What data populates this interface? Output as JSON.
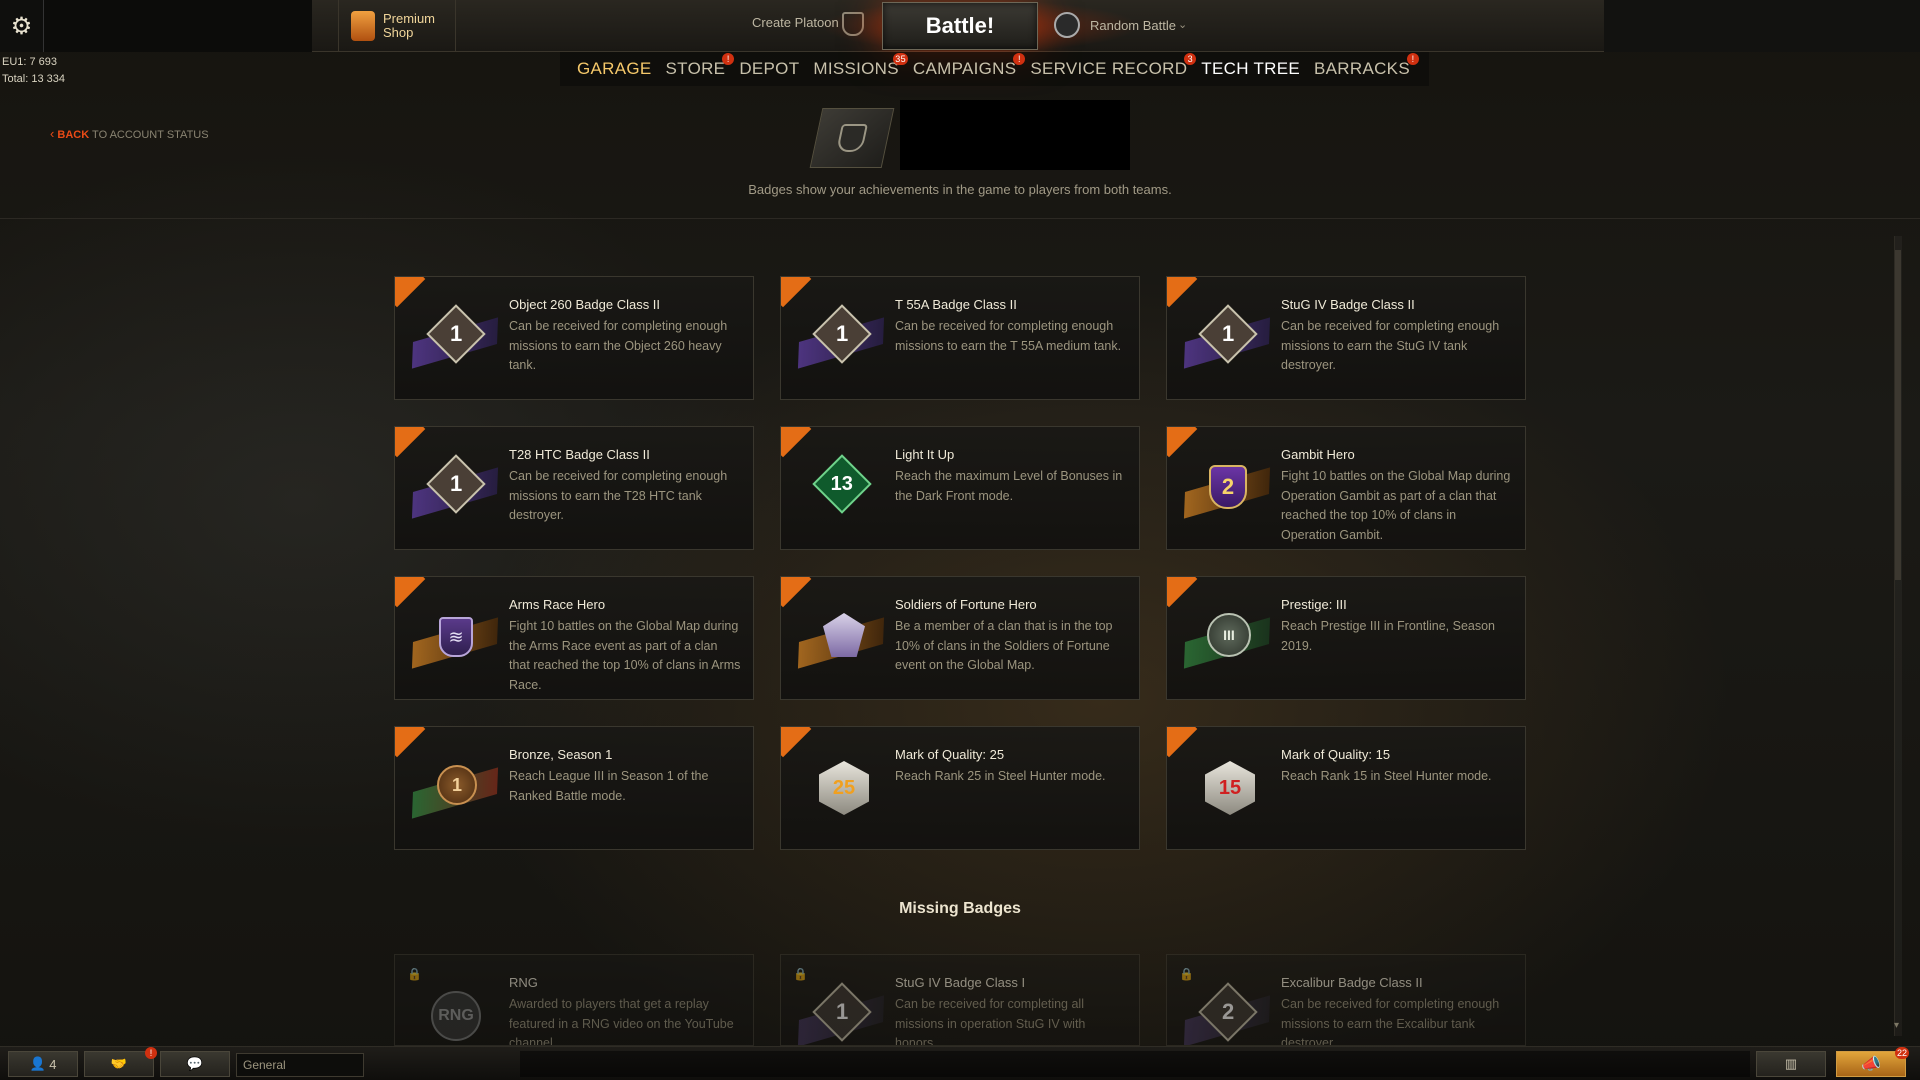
{
  "account": {
    "eu1_label": "EU1: 7 693",
    "total_label": "Total: 13 334"
  },
  "topbar": {
    "premium_line1": "Premium",
    "premium_line2": "Shop",
    "create_platoon": "Create Platoon",
    "battle": "Battle!",
    "battle_mode": "Random Battle"
  },
  "nav": [
    {
      "label": "Garage",
      "badge": ""
    },
    {
      "label": "Store",
      "badge": "!"
    },
    {
      "label": "Depot",
      "badge": ""
    },
    {
      "label": "Missions",
      "badge": "35"
    },
    {
      "label": "Campaigns",
      "badge": "!"
    },
    {
      "label": "Service Record",
      "badge": "3"
    },
    {
      "label": "Tech Tree",
      "badge": ""
    },
    {
      "label": "Barracks",
      "badge": "!"
    }
  ],
  "back": {
    "label": "BACK",
    "target": "TO ACCOUNT STATUS"
  },
  "header": {
    "description": "Badges show your achievements in the game to players from both teams."
  },
  "badges": [
    {
      "title": "Object 260 Badge Class II",
      "desc": "Can be received for completing enough missions to earn the Object 260 heavy tank.",
      "icon": "class-badge-icon",
      "num": "1",
      "theme": "purple"
    },
    {
      "title": "T 55A Badge Class II",
      "desc": "Can be received for completing enough missions to earn the T 55A medium tank.",
      "icon": "class-badge-icon",
      "num": "1",
      "theme": "purple"
    },
    {
      "title": "StuG IV Badge Class II",
      "desc": "Can be received for completing enough missions to earn the StuG IV tank destroyer.",
      "icon": "class-badge-icon",
      "num": "1",
      "theme": "purple"
    },
    {
      "title": "T28 HTC Badge Class II",
      "desc": "Can be received for completing enough missions to earn the T28 HTC tank destroyer.",
      "icon": "class-badge-icon",
      "num": "1",
      "theme": "purple"
    },
    {
      "title": "Light It Up",
      "desc": "Reach the maximum Level of Bonuses in the Dark Front mode.",
      "icon": "green-diamond-icon",
      "num": "13",
      "theme": "green"
    },
    {
      "title": "Gambit Hero",
      "desc": "Fight 10 battles on the Global Map during Operation Gambit as part of a clan that reached the top 10% of clans in Operation Gambit.",
      "icon": "shield-2-icon",
      "num": "2",
      "theme": "orange"
    },
    {
      "title": "Arms Race Hero",
      "desc": "Fight 10 battles on the Global Map during the Arms Race event as part of a clan that reached the top 10% of clans in Arms Race.",
      "icon": "claw-shield-icon",
      "num": "",
      "theme": "orange"
    },
    {
      "title": "Soldiers of Fortune Hero",
      "desc": "Be a member of a clan that is in the top 10% of clans in the Soldiers of Fortune event on the Global Map.",
      "icon": "winged-emblem-icon",
      "num": "",
      "theme": "orange"
    },
    {
      "title": "Prestige: III",
      "desc": "Reach Prestige III in Frontline, Season 2019.",
      "icon": "prestige-emblem-icon",
      "num": "III",
      "theme": "green"
    },
    {
      "title": "Bronze, Season 1",
      "desc": "Reach League III in Season 1 of the Ranked Battle mode.",
      "icon": "bronze-league-icon",
      "num": "1",
      "theme": "green"
    },
    {
      "title": "Mark of Quality: 25",
      "desc": "Reach Rank 25 in Steel Hunter mode.",
      "icon": "mark-of-quality-icon",
      "num": "25",
      "theme": "red"
    },
    {
      "title": "Mark of Quality: 15",
      "desc": "Reach Rank 15 in Steel Hunter mode.",
      "icon": "mark-of-quality-icon",
      "num": "15",
      "theme": "red"
    }
  ],
  "missing_title": "Missing Badges",
  "missing": [
    {
      "title": "RNG",
      "desc": "Awarded to players that get a replay featured in a RNG video on the YouTube channel.",
      "num": "RNG"
    },
    {
      "title": "StuG IV Badge Class I",
      "desc": "Can be received for completing all missions in operation StuG IV with honors.",
      "num": "1"
    },
    {
      "title": "Excalibur Badge Class II",
      "desc": "Can be received for completing enough missions to earn the Excalibur tank destroyer.",
      "num": "2"
    }
  ],
  "bottombar": {
    "friends_count": "4",
    "clan_badge": "!",
    "chat_channel": "General",
    "notifications": "22"
  }
}
